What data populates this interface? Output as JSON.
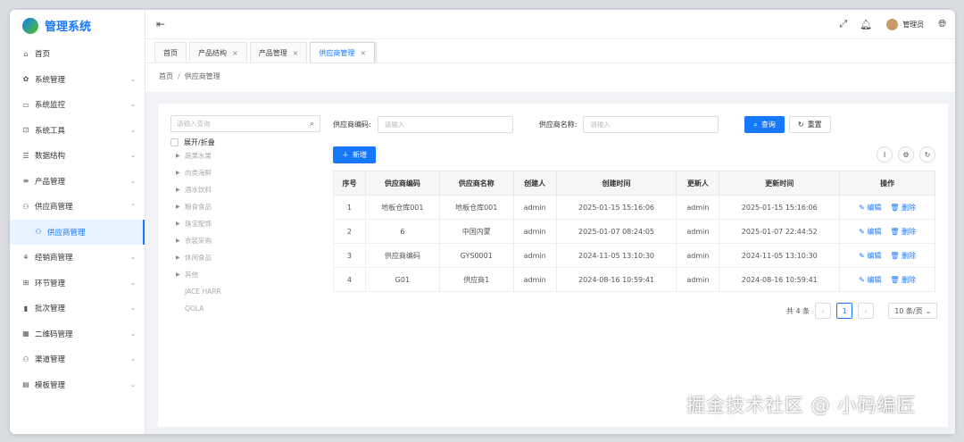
{
  "app": {
    "title": "管理系统"
  },
  "sidebar": {
    "items": [
      {
        "label": "首页",
        "icon": "home-icon",
        "glyph": "⌂",
        "chevron": ""
      },
      {
        "label": "系统管理",
        "icon": "gear-icon",
        "glyph": "✿",
        "chevron": "⌄"
      },
      {
        "label": "系统监控",
        "icon": "monitor-icon",
        "glyph": "▭",
        "chevron": "⌄"
      },
      {
        "label": "系统工具",
        "icon": "toolbox-icon",
        "glyph": "⊡",
        "chevron": "⌄"
      },
      {
        "label": "数据结构",
        "icon": "sliders-icon",
        "glyph": "☰",
        "chevron": "⌄"
      },
      {
        "label": "产品管理",
        "icon": "list-icon",
        "glyph": "≡",
        "chevron": "⌄"
      },
      {
        "label": "供应商管理",
        "icon": "people-icon",
        "glyph": "⚇",
        "chevron": "⌃"
      }
    ],
    "sub_item": {
      "label": "供应商管理",
      "glyph": "⚇"
    },
    "items_after": [
      {
        "label": "经销商管理",
        "icon": "distributor-icon",
        "glyph": "⚘",
        "chevron": "⌄"
      },
      {
        "label": "环节管理",
        "icon": "link-icon",
        "glyph": "⊞",
        "chevron": "⌄"
      },
      {
        "label": "批次管理",
        "icon": "barcode-icon",
        "glyph": "▮",
        "chevron": "⌄"
      },
      {
        "label": "二维码管理",
        "icon": "qrcode-icon",
        "glyph": "▦",
        "chevron": "⌄"
      },
      {
        "label": "渠道管理",
        "icon": "channel-icon",
        "glyph": "⚇",
        "chevron": "⌄"
      },
      {
        "label": "模板管理",
        "icon": "template-icon",
        "glyph": "▤",
        "chevron": "⌄"
      }
    ]
  },
  "header": {
    "fold_glyph": "⇤",
    "user": "管理员"
  },
  "tabs": [
    {
      "label": "首页",
      "closable": false
    },
    {
      "label": "产品结构",
      "closable": true
    },
    {
      "label": "产品管理",
      "closable": true
    },
    {
      "label": "供应商管理",
      "closable": true,
      "active": true
    }
  ],
  "breadcrumb": {
    "home": "首页",
    "sep": "/",
    "current": "供应商管理"
  },
  "tree": {
    "search_placeholder": "请输入查询",
    "expand_label": "展开/折叠",
    "nodes": [
      "蔬果水果",
      "肉类海鲜",
      "酒水饮料",
      "粮食食品",
      "珠宝配饰",
      "衣装采购",
      "休闲食品",
      "其他"
    ],
    "leaves": [
      "JACE HARR",
      "QOLA"
    ]
  },
  "filters": {
    "code_label": "供应商编码:",
    "code_placeholder": "请输入",
    "name_label": "供应商名称:",
    "name_placeholder": "请输入",
    "search_label": "查询",
    "reset_label": "重置"
  },
  "toolbar": {
    "add_label": "新增"
  },
  "table": {
    "headers": [
      "序号",
      "供应商编码",
      "供应商名称",
      "创建人",
      "创建时间",
      "更新人",
      "更新时间",
      "操作"
    ],
    "edit_label": "编辑",
    "delete_label": "删除",
    "rows": [
      [
        "1",
        "地板仓库001",
        "地板仓库001",
        "admin",
        "2025-01-15 15:16:06",
        "admin",
        "2025-01-15 15:16:06"
      ],
      [
        "2",
        "6",
        "中国内蒙",
        "admin",
        "2025-01-07 08:24:05",
        "admin",
        "2025-01-07 22:44:52"
      ],
      [
        "3",
        "供应商编码",
        "GYS0001",
        "admin",
        "2024-11-05 13:10:30",
        "admin",
        "2024-11-05 13:10:30"
      ],
      [
        "4",
        "G01",
        "供应商1",
        "admin",
        "2024-08-16 10:59:41",
        "admin",
        "2024-08-16 10:59:41"
      ]
    ]
  },
  "pagination": {
    "total": "共 4 条",
    "current": "1",
    "size": "10 条/页"
  },
  "watermark": "掘金技术社区 @ 小码编匠",
  "colors": {
    "primary": "#1677ff"
  }
}
